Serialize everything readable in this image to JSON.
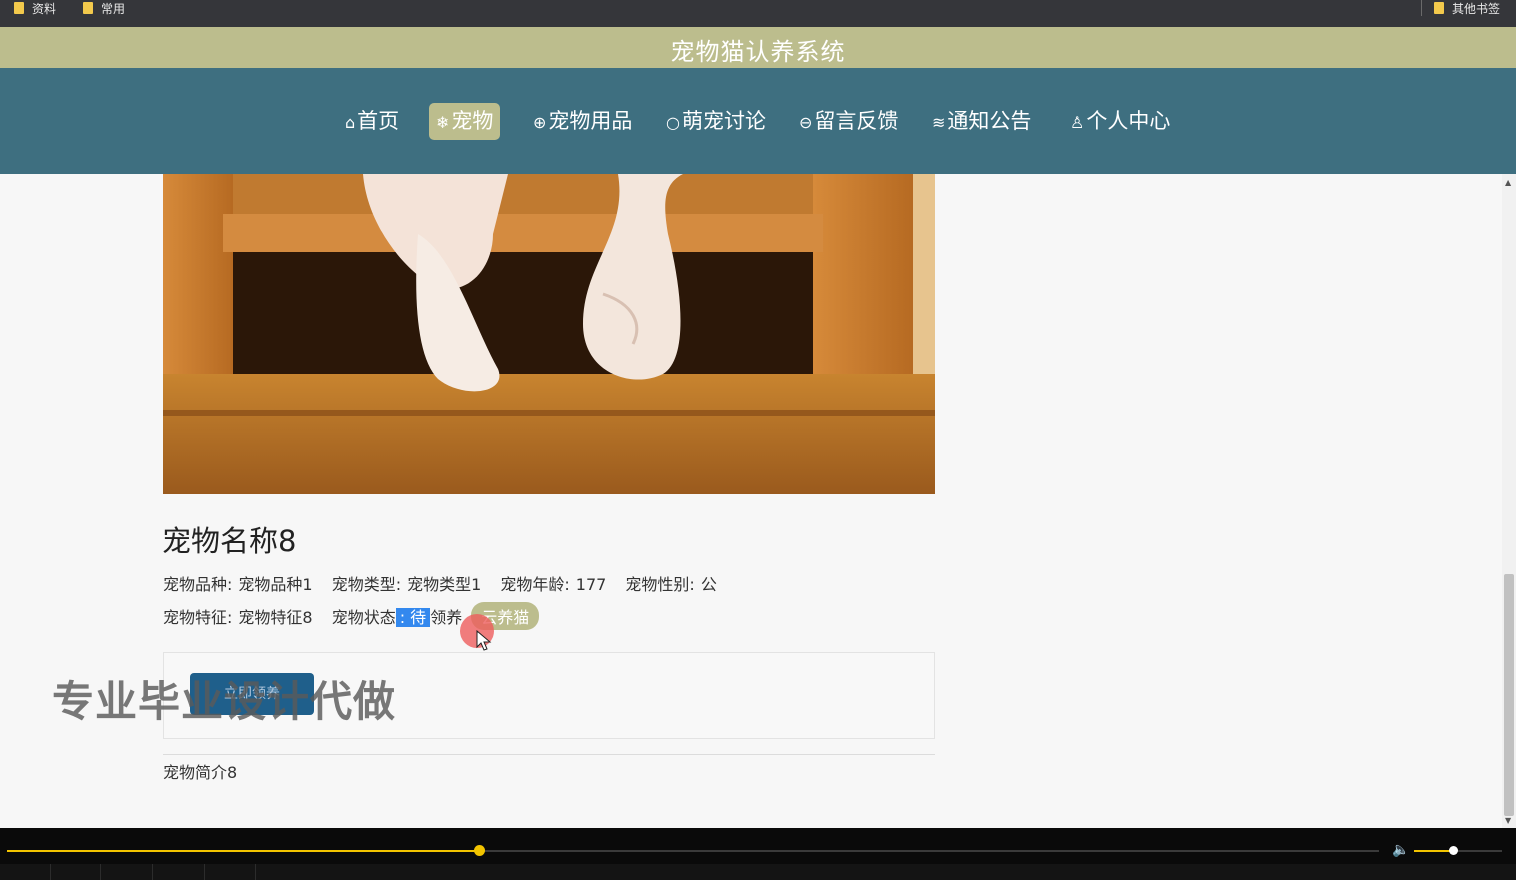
{
  "bookmarks": {
    "items": [
      {
        "label": "资料",
        "icon": "folder-icon"
      },
      {
        "label": "常用",
        "icon": "folder-icon"
      }
    ],
    "other_label": "其他书签"
  },
  "site": {
    "title": "宠物猫认养系统"
  },
  "nav": {
    "items": [
      {
        "label": "首页",
        "icon": "⌂",
        "icon_name": "home-icon"
      },
      {
        "label": "宠物",
        "icon": "❄",
        "icon_name": "pet-icon"
      },
      {
        "label": "宠物用品",
        "icon": "⊕",
        "icon_name": "supplies-icon"
      },
      {
        "label": "萌宠讨论",
        "icon": "○",
        "icon_name": "discussion-icon"
      },
      {
        "label": "留言反馈",
        "icon": "⊖",
        "icon_name": "feedback-icon"
      },
      {
        "label": "通知公告",
        "icon": "≋",
        "icon_name": "notice-icon"
      },
      {
        "label": "个人中心",
        "icon": "♙",
        "icon_name": "user-icon"
      }
    ],
    "active_index": 1,
    "active_color": "#bcbd8d",
    "bar_color": "#3e6f80"
  },
  "pet": {
    "name": "宠物名称8",
    "breed_label": "宠物品种:",
    "breed": "宠物品种1",
    "type_label": "宠物类型:",
    "type": "宠物类型1",
    "age_label": "宠物年龄:",
    "age": "177",
    "gender_label": "宠物性别:",
    "gender": "公",
    "feature_label": "宠物特征:",
    "feature": "宠物特征8",
    "status_label": "宠物状态",
    "status_selected": ": 待",
    "status_rest": "领养",
    "tag": "云养猫",
    "adopt_button": "立即领养",
    "intro": "宠物简介8"
  },
  "overlay": {
    "watermark": "专业毕业设计代做"
  },
  "player": {
    "progress": 0.344,
    "volume": 0.44
  }
}
